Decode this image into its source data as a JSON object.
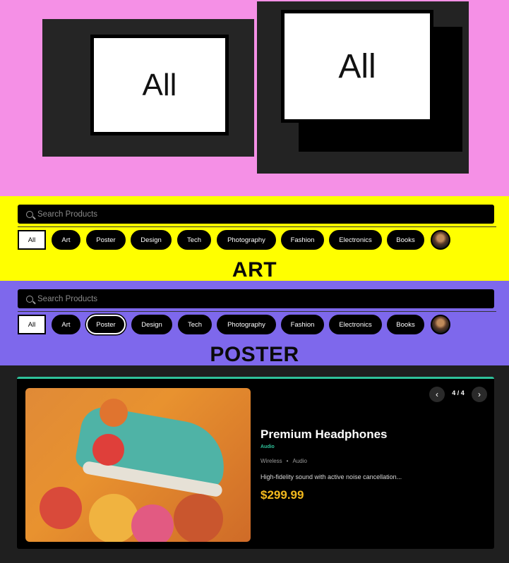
{
  "zoom": {
    "left_label": "All",
    "right_label": "All"
  },
  "search": {
    "placeholder": "Search Products"
  },
  "filters": [
    "All",
    "Art",
    "Poster",
    "Design",
    "Tech",
    "Photography",
    "Fashion",
    "Electronics",
    "Books"
  ],
  "band_art": {
    "heading": "ART",
    "active": "All"
  },
  "band_poster": {
    "heading": "POSTER",
    "active": "Poster"
  },
  "product": {
    "title": "Premium Headphones",
    "category": "Audio",
    "tags": [
      "Wireless",
      "Audio"
    ],
    "description": "High-fidelity sound with active noise cancellation...",
    "price": "$299.99",
    "pager": "4 / 4",
    "image": "shoe-with-flowers-photo"
  },
  "colors": {
    "pink": "#f590e6",
    "yellow": "#ffff00",
    "purple": "#7e68ec",
    "accent": "#2ec19a",
    "price": "#f3b91d"
  }
}
